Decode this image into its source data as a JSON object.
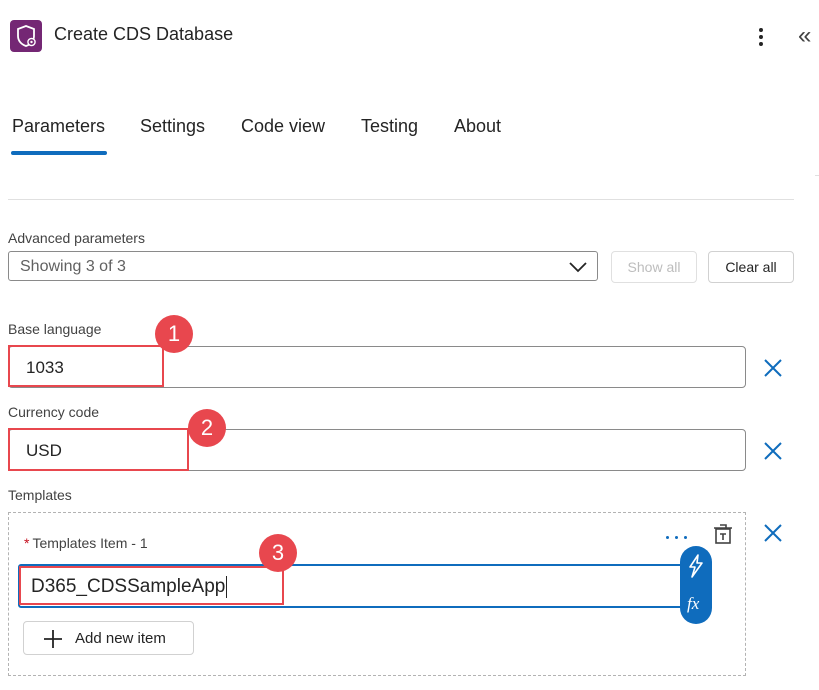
{
  "header": {
    "title": "Create CDS Database",
    "app_icon": "shield-settings-icon",
    "more_icon": "more-vertical-icon",
    "collapse_icon": "double-chevron-left-icon",
    "collapse_glyph": "«"
  },
  "tabs": [
    {
      "label": "Parameters",
      "active": true
    },
    {
      "label": "Settings",
      "active": false
    },
    {
      "label": "Code view",
      "active": false
    },
    {
      "label": "Testing",
      "active": false
    },
    {
      "label": "About",
      "active": false
    }
  ],
  "advanced": {
    "label": "Advanced parameters",
    "value": "Showing 3 of 3",
    "show_all": "Show all",
    "clear_all": "Clear all"
  },
  "params": {
    "base_language": {
      "label": "Base language",
      "value": "1033"
    },
    "currency_code": {
      "label": "Currency code",
      "value": "USD"
    },
    "templates": {
      "label": "Templates",
      "item_label": "Templates Item - 1",
      "required_marker": "*",
      "item_value": "D365_CDSSampleApp",
      "add_label": "Add new item"
    }
  },
  "annotations": [
    "1",
    "2",
    "3"
  ],
  "colors": {
    "accent": "#0f6cbd",
    "highlight": "#e8474e",
    "app_icon_bg": "#742774"
  }
}
